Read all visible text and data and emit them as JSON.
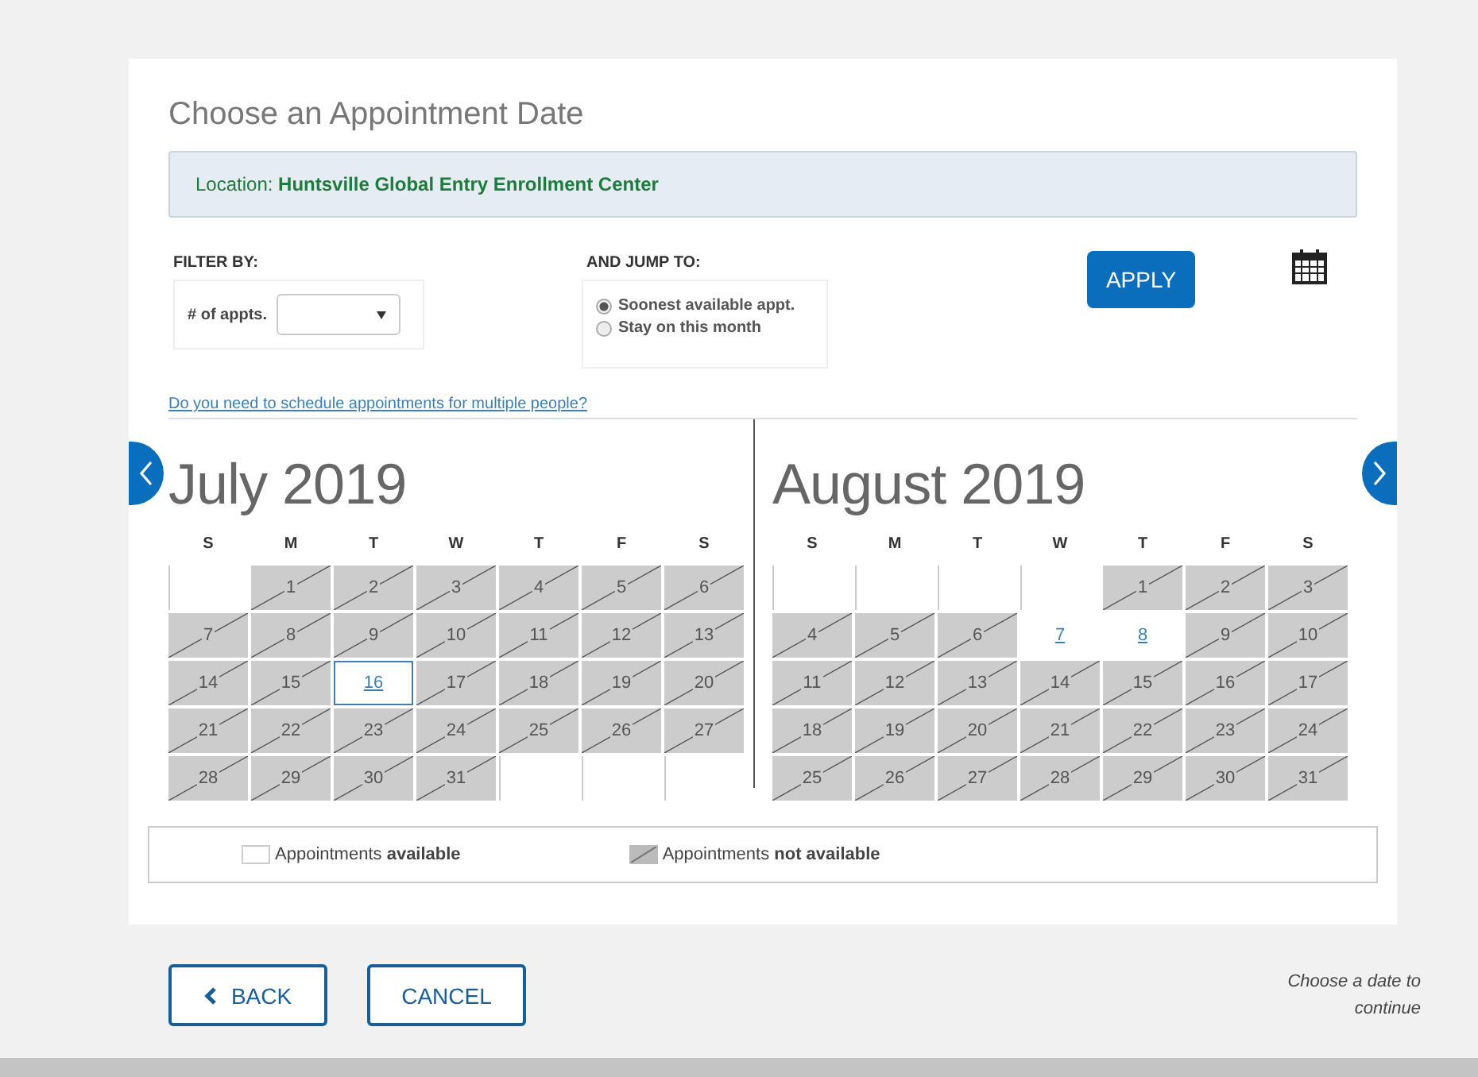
{
  "title": "Choose an Appointment Date",
  "location": {
    "label": "Location:",
    "value": "Huntsville Global Entry Enrollment Center"
  },
  "filter": {
    "heading": "FILTER BY:",
    "field_label": "# of appts."
  },
  "jump": {
    "heading": "AND JUMP TO:",
    "options": [
      {
        "label": "Soonest available appt.",
        "selected": true
      },
      {
        "label": "Stay on this month",
        "selected": false
      }
    ]
  },
  "apply_button": "APPLY",
  "multiple_link": "Do you need to schedule appointments for multiple people?",
  "calendars": [
    {
      "title": "July 2019",
      "weekdays": [
        "S",
        "M",
        "T",
        "W",
        "T",
        "F",
        "S"
      ],
      "weeks": [
        [
          {
            "kind": "empty"
          },
          {
            "kind": "day",
            "day": "1",
            "available": false,
            "selected": false
          },
          {
            "kind": "day",
            "day": "2",
            "available": false,
            "selected": false
          },
          {
            "kind": "day",
            "day": "3",
            "available": false,
            "selected": false
          },
          {
            "kind": "day",
            "day": "4",
            "available": false,
            "selected": false
          },
          {
            "kind": "day",
            "day": "5",
            "available": false,
            "selected": false
          },
          {
            "kind": "day",
            "day": "6",
            "available": false,
            "selected": false
          }
        ],
        [
          {
            "kind": "day",
            "day": "7",
            "available": false,
            "selected": false
          },
          {
            "kind": "day",
            "day": "8",
            "available": false,
            "selected": false
          },
          {
            "kind": "day",
            "day": "9",
            "available": false,
            "selected": false
          },
          {
            "kind": "day",
            "day": "10",
            "available": false,
            "selected": false
          },
          {
            "kind": "day",
            "day": "11",
            "available": false,
            "selected": false
          },
          {
            "kind": "day",
            "day": "12",
            "available": false,
            "selected": false
          },
          {
            "kind": "day",
            "day": "13",
            "available": false,
            "selected": false
          }
        ],
        [
          {
            "kind": "day",
            "day": "14",
            "available": false,
            "selected": false
          },
          {
            "kind": "day",
            "day": "15",
            "available": false,
            "selected": false
          },
          {
            "kind": "day",
            "day": "16",
            "available": true,
            "selected": true
          },
          {
            "kind": "day",
            "day": "17",
            "available": false,
            "selected": false
          },
          {
            "kind": "day",
            "day": "18",
            "available": false,
            "selected": false
          },
          {
            "kind": "day",
            "day": "19",
            "available": false,
            "selected": false
          },
          {
            "kind": "day",
            "day": "20",
            "available": false,
            "selected": false
          }
        ],
        [
          {
            "kind": "day",
            "day": "21",
            "available": false,
            "selected": false
          },
          {
            "kind": "day",
            "day": "22",
            "available": false,
            "selected": false
          },
          {
            "kind": "day",
            "day": "23",
            "available": false,
            "selected": false
          },
          {
            "kind": "day",
            "day": "24",
            "available": false,
            "selected": false
          },
          {
            "kind": "day",
            "day": "25",
            "available": false,
            "selected": false
          },
          {
            "kind": "day",
            "day": "26",
            "available": false,
            "selected": false
          },
          {
            "kind": "day",
            "day": "27",
            "available": false,
            "selected": false
          }
        ],
        [
          {
            "kind": "day",
            "day": "28",
            "available": false,
            "selected": false
          },
          {
            "kind": "day",
            "day": "29",
            "available": false,
            "selected": false
          },
          {
            "kind": "day",
            "day": "30",
            "available": false,
            "selected": false
          },
          {
            "kind": "day",
            "day": "31",
            "available": false,
            "selected": false
          },
          {
            "kind": "empty"
          },
          {
            "kind": "empty"
          },
          {
            "kind": "empty"
          }
        ]
      ]
    },
    {
      "title": "August 2019",
      "weekdays": [
        "S",
        "M",
        "T",
        "W",
        "T",
        "F",
        "S"
      ],
      "weeks": [
        [
          {
            "kind": "empty"
          },
          {
            "kind": "empty"
          },
          {
            "kind": "empty"
          },
          {
            "kind": "empty"
          },
          {
            "kind": "day",
            "day": "1",
            "available": false,
            "selected": false
          },
          {
            "kind": "day",
            "day": "2",
            "available": false,
            "selected": false
          },
          {
            "kind": "day",
            "day": "3",
            "available": false,
            "selected": false
          }
        ],
        [
          {
            "kind": "day",
            "day": "4",
            "available": false,
            "selected": false
          },
          {
            "kind": "day",
            "day": "5",
            "available": false,
            "selected": false
          },
          {
            "kind": "day",
            "day": "6",
            "available": false,
            "selected": false
          },
          {
            "kind": "day",
            "day": "7",
            "available": true,
            "selected": false
          },
          {
            "kind": "day",
            "day": "8",
            "available": true,
            "selected": false
          },
          {
            "kind": "day",
            "day": "9",
            "available": false,
            "selected": false
          },
          {
            "kind": "day",
            "day": "10",
            "available": false,
            "selected": false
          }
        ],
        [
          {
            "kind": "day",
            "day": "11",
            "available": false,
            "selected": false
          },
          {
            "kind": "day",
            "day": "12",
            "available": false,
            "selected": false
          },
          {
            "kind": "day",
            "day": "13",
            "available": false,
            "selected": false
          },
          {
            "kind": "day",
            "day": "14",
            "available": false,
            "selected": false
          },
          {
            "kind": "day",
            "day": "15",
            "available": false,
            "selected": false
          },
          {
            "kind": "day",
            "day": "16",
            "available": false,
            "selected": false
          },
          {
            "kind": "day",
            "day": "17",
            "available": false,
            "selected": false
          }
        ],
        [
          {
            "kind": "day",
            "day": "18",
            "available": false,
            "selected": false
          },
          {
            "kind": "day",
            "day": "19",
            "available": false,
            "selected": false
          },
          {
            "kind": "day",
            "day": "20",
            "available": false,
            "selected": false
          },
          {
            "kind": "day",
            "day": "21",
            "available": false,
            "selected": false
          },
          {
            "kind": "day",
            "day": "22",
            "available": false,
            "selected": false
          },
          {
            "kind": "day",
            "day": "23",
            "available": false,
            "selected": false
          },
          {
            "kind": "day",
            "day": "24",
            "available": false,
            "selected": false
          }
        ],
        [
          {
            "kind": "day",
            "day": "25",
            "available": false,
            "selected": false
          },
          {
            "kind": "day",
            "day": "26",
            "available": false,
            "selected": false
          },
          {
            "kind": "day",
            "day": "27",
            "available": false,
            "selected": false
          },
          {
            "kind": "day",
            "day": "28",
            "available": false,
            "selected": false
          },
          {
            "kind": "day",
            "day": "29",
            "available": false,
            "selected": false
          },
          {
            "kind": "day",
            "day": "30",
            "available": false,
            "selected": false
          },
          {
            "kind": "day",
            "day": "31",
            "available": false,
            "selected": false
          }
        ]
      ]
    }
  ],
  "legend": [
    {
      "kind": "available",
      "text": "Appointments **available**"
    },
    {
      "kind": "unavailable",
      "text": "Appointments **not available**"
    }
  ],
  "back_button": "BACK",
  "cancel_button": "CANCEL",
  "footer_note": "Choose a date to continue"
}
